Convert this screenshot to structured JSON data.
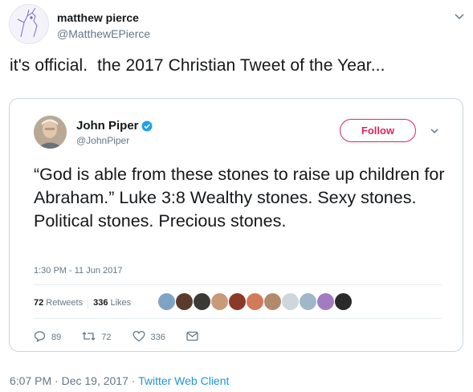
{
  "tweet": {
    "author_name": "matthew pierce",
    "author_handle": "@MatthewEPierce",
    "text": "it's official.  the 2017 Christian Tweet of the Year...",
    "timestamp": "6:07 PM · Dec 19, 2017 · ",
    "client": "Twitter Web Client"
  },
  "quoted": {
    "author_name": "John Piper",
    "author_handle": "@JohnPiper",
    "follow_label": "Follow",
    "text": "“God is able from these stones to raise up children for Abraham.” Luke 3:8 Wealthy stones. Sexy stones. Political stones. Precious stones.",
    "timestamp": "1:30 PM - 11 Jun 2017",
    "retweets_count": "72",
    "retweets_label": "Retweets",
    "likes_count": "336",
    "likes_label": "Likes",
    "reply_count": "89",
    "retweet_action_count": "72",
    "like_action_count": "336"
  },
  "colors": {
    "follow": "#e0245e",
    "link": "#1b95e0",
    "verified": "#1da1f2",
    "muted": "#657786"
  },
  "icons": [
    "chevron-down-icon",
    "verified-icon",
    "reply-icon",
    "retweet-icon",
    "heart-icon",
    "message-icon"
  ]
}
